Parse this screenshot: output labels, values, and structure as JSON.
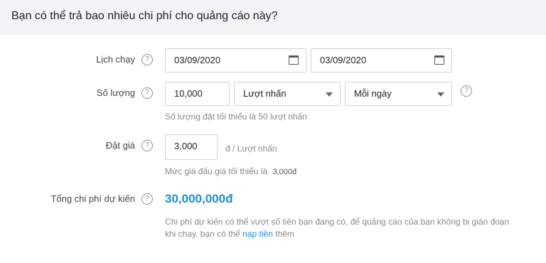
{
  "header": {
    "title": "Bạn có thể trả bao nhiêu chi phí cho quảng cáo này?"
  },
  "schedule": {
    "label": "Lịch chạy",
    "start_date": "03/09/2020",
    "end_date": "03/09/2020"
  },
  "quantity": {
    "label": "Số lượng",
    "value": "10,000",
    "unit_selected": "Lượt nhấn",
    "period_selected": "Mỗi ngày",
    "hint": "Số lượng đặt tối thiểu là 50 lượt nhấn"
  },
  "bid": {
    "label": "Đặt giá",
    "value": "3,000",
    "unit": "đ / Lượt nhấn",
    "hint": "Mức giá đấu giá tối thiểu là",
    "hint_value": "3,000đ"
  },
  "total": {
    "label": "Tổng chi phí dự kiến",
    "value": "30,000,000đ",
    "note_part1": "Chi phí dự kiến có thể vượt số tiền bạn đang có, để quảng cáo của bạn không bị gián đoạn",
    "note_part2": "khi chạy, bạn có thể",
    "note_link": "nạp tiền",
    "note_part3": "thêm"
  },
  "help_glyph": "?",
  "colors": {
    "accent": "#1a8ce0",
    "header_bg": "#f2f4f8"
  }
}
